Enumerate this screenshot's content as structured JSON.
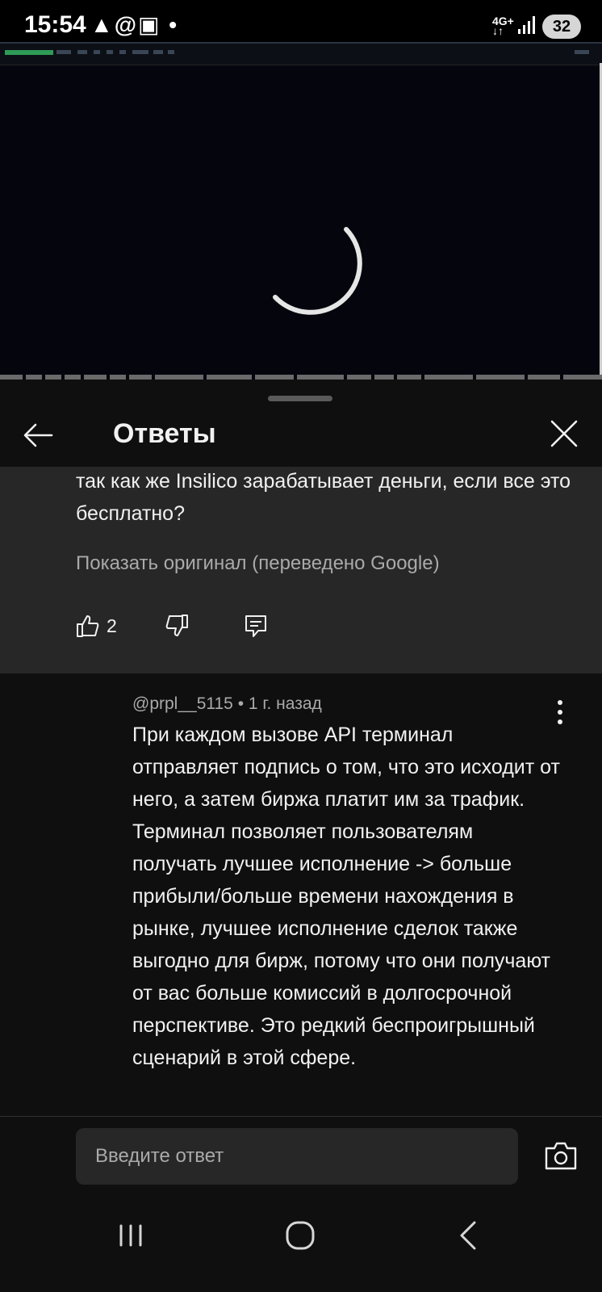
{
  "status_bar": {
    "time": "15:54",
    "left_icons": "▲@▣ •",
    "network_top": "4G+",
    "network_bottom": "↓↑",
    "battery": "32"
  },
  "sheet": {
    "title": "Ответы"
  },
  "parent_comment": {
    "text": "так как же Insilico зарабатывает деньги, если все это бесплатно?",
    "show_original": "Показать оригинал (переведено Google)",
    "likes": "2"
  },
  "reply_comment": {
    "author": "@prpl__5115",
    "time": "1 г. назад",
    "separator": " • ",
    "text": "При каждом вызове API терминал отправляет подпись о том, что это исходит от него, а затем биржа платит им за трафик. Терминал позволяет пользователям получать лучшее исполнение -> больше прибыли/больше времени нахождения в рынке, лучшее исполнение сделок также выгодно для бирж, потому что они получают от вас больше комиссий в долгосрочной перспективе. Это редкий беспроигрышный сценарий в этой сфере."
  },
  "reply_input": {
    "placeholder": "Введите ответ"
  },
  "icons": {
    "back": "arrow-left-icon",
    "close": "close-icon",
    "like": "thumbs-up-icon",
    "dislike": "thumbs-down-icon",
    "reply": "comment-icon",
    "more": "more-vertical-icon",
    "camera": "camera-icon"
  },
  "colors": {
    "background": "#0f0f0f",
    "highlight": "#272727",
    "secondary_text": "#aaaaaa"
  }
}
